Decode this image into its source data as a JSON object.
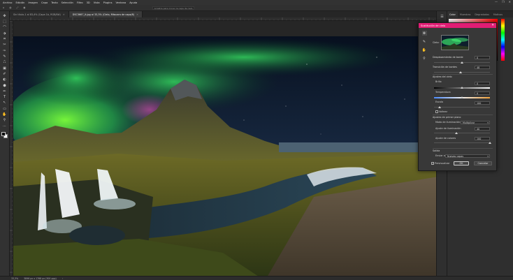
{
  "menu": [
    "Archivo",
    "Edición",
    "Imagen",
    "Capa",
    "Texto",
    "Selección",
    "Filtro",
    "3D",
    "Vista",
    "Plugins",
    "Ventana",
    "Ayuda"
  ],
  "window_controls": [
    "—",
    "❐",
    "✕"
  ],
  "options_bar": {
    "items": [
      "⌂",
      "◍",
      "⤢",
      "◉"
    ],
    "hint": "Arrastre para mover la capa de cielo"
  },
  "tabs": [
    {
      "label": "Sin título-1 al 83,4% (Capa 1b, RGB/8#)",
      "active": false
    },
    {
      "label": "DSC3667_lt.jpg al 33,3% (Cielo, Máscara de capa/8)",
      "active": true
    }
  ],
  "tools": [
    "✥",
    "⬚",
    "⌒",
    "⬗",
    "⌗",
    "✂",
    "✑",
    "✎",
    "⎍",
    "▣",
    "✐",
    "◐",
    "⬢",
    "✏",
    "T",
    "↖",
    "▭",
    "✋",
    "⚲",
    "⋯"
  ],
  "right_panel": {
    "tabs": [
      {
        "label": "Color",
        "active": true
      },
      {
        "label": "Muestras",
        "active": false
      },
      {
        "label": "Degradados",
        "active": false
      },
      {
        "label": "Motivos",
        "active": false
      }
    ]
  },
  "icon_strip": [
    "☰",
    "◷",
    "⚑",
    "▤",
    "⚙",
    "◫",
    "✦"
  ],
  "dialog": {
    "title": "Sustitución de cielo",
    "close": "✕",
    "tools": [
      "✥",
      "✎",
      "✋",
      "⚲"
    ],
    "sky_label": "Cielo:",
    "shift_edge": {
      "label": "Desplazamiento de borde",
      "value": "0",
      "slider": 0.5
    },
    "fade_edge": {
      "label": "Transición de bordes",
      "value": "48",
      "slider": 0.48
    },
    "sky_adjust_header": "Ajustes del cielo",
    "brightness": {
      "label": "Brillo",
      "value": "0",
      "slider": 0.5
    },
    "temperature": {
      "label": "Temperatura",
      "value": "0",
      "slider": 0.5
    },
    "scale": {
      "label": "Escala",
      "value": "100",
      "slider": 0.1
    },
    "flip_label": "Voltear",
    "foreground_header": "Ajustes de primer plano",
    "lighting_mode_label": "Modo de iluminación:",
    "lighting_mode_value": "Multiplicar",
    "lighting_adjust": {
      "label": "Ajuste de iluminación",
      "value": "40",
      "slider": 0.4
    },
    "color_adjust": {
      "label": "Ajuste de colores",
      "value": "100",
      "slider": 1.0
    },
    "output_header": "Salida",
    "output_to_label": "Enviar a:",
    "output_to_value": "Nuevas capas",
    "preview_label": "Previsualizar",
    "preview_checked": "✓",
    "ok": "OK",
    "cancel": "Cancelar"
  },
  "status": {
    "zoom": "33,3%",
    "doc": "3896 px x 1768 px (300 ppp)",
    "arrow": "›"
  }
}
